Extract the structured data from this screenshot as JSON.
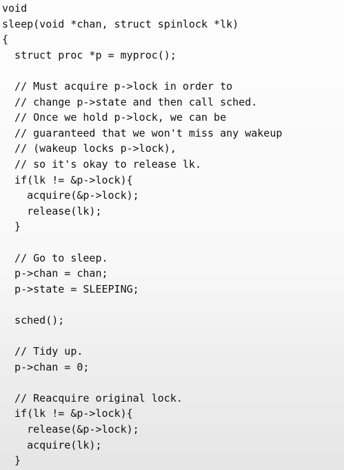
{
  "code_lines": [
    "void",
    "sleep(void *chan, struct spinlock *lk)",
    "{",
    "  struct proc *p = myproc();",
    "",
    "  // Must acquire p->lock in order to",
    "  // change p->state and then call sched.",
    "  // Once we hold p->lock, we can be",
    "  // guaranteed that we won't miss any wakeup",
    "  // (wakeup locks p->lock),",
    "  // so it's okay to release lk.",
    "  if(lk != &p->lock){",
    "    acquire(&p->lock);",
    "    release(lk);",
    "  }",
    "",
    "  // Go to sleep.",
    "  p->chan = chan;",
    "  p->state = SLEEPING;",
    "",
    "  sched();",
    "",
    "  // Tidy up.",
    "  p->chan = 0;",
    "",
    "  // Reacquire original lock.",
    "  if(lk != &p->lock){",
    "    release(&p->lock);",
    "    acquire(lk);",
    "  }",
    "}"
  ]
}
